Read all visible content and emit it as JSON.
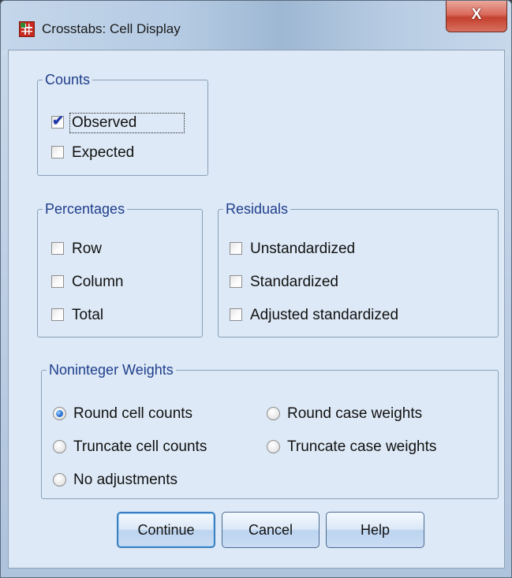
{
  "window": {
    "title": "Crosstabs: Cell Display",
    "close_glyph": "X"
  },
  "counts": {
    "legend": "Counts",
    "observed": {
      "label": "Observed",
      "checked": true
    },
    "expected": {
      "label": "Expected",
      "checked": false
    }
  },
  "percentages": {
    "legend": "Percentages",
    "row": {
      "label": "Row",
      "checked": false
    },
    "column": {
      "label": "Column",
      "checked": false
    },
    "total": {
      "label": "Total",
      "checked": false
    }
  },
  "residuals": {
    "legend": "Residuals",
    "unstandardized": {
      "label": "Unstandardized",
      "checked": false
    },
    "standardized": {
      "label": "Standardized",
      "checked": false
    },
    "adjusted": {
      "label": "Adjusted standardized",
      "checked": false
    }
  },
  "weights": {
    "legend": "Noninteger Weights",
    "selected": "round_cell_counts",
    "options": {
      "round_cell_counts": "Round cell counts",
      "round_case_weights": "Round case weights",
      "truncate_cell_counts": "Truncate cell counts",
      "truncate_case_weights": "Truncate case weights",
      "no_adjustments": "No adjustments"
    }
  },
  "buttons": {
    "continue": "Continue",
    "cancel": "Cancel",
    "help": "Help"
  },
  "colors": {
    "legend_text": "#1f3e8c",
    "client_bg": "#dde9f6",
    "close_button": "#c5402f",
    "radio_selected": "#2b74d4"
  },
  "icons": {
    "app": "spss-table-icon",
    "close": "close-icon"
  }
}
